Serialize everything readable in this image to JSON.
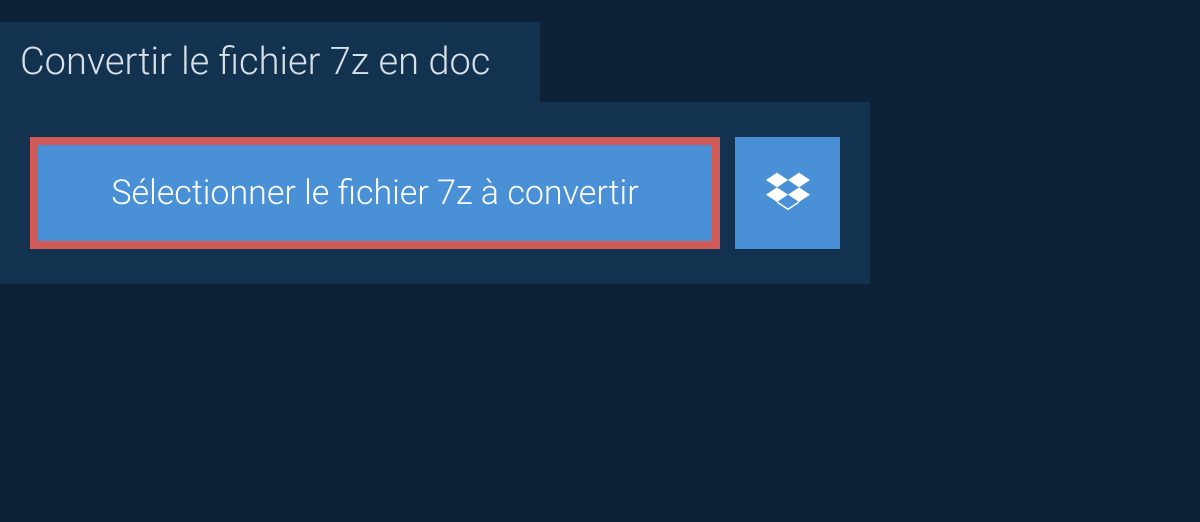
{
  "header": {
    "tab_label": "Convertir le fichier 7z en doc"
  },
  "panel": {
    "select_button_label": "Sélectionner le fichier 7z à convertir"
  }
}
